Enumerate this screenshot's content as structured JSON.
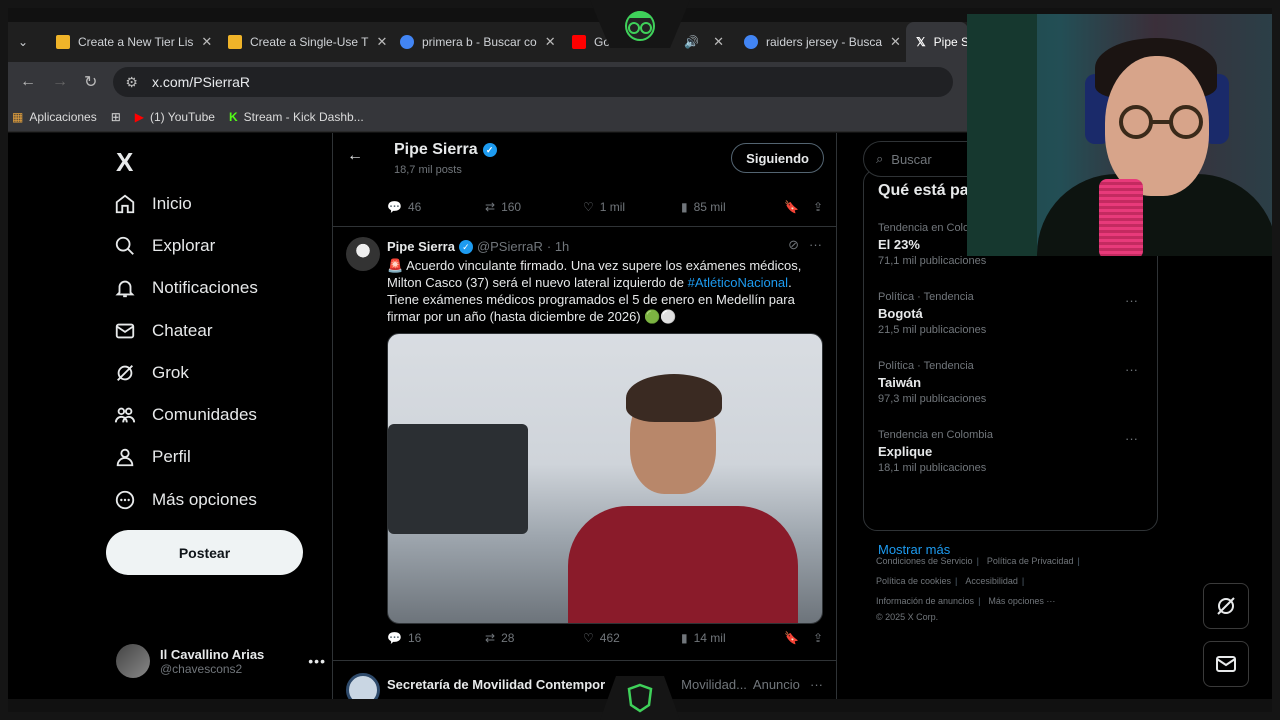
{
  "browser": {
    "tabs": [
      {
        "title": "Create a New Tier Lis",
        "icon_color": "#f0b429"
      },
      {
        "title": "Create a Single-Use T",
        "icon_color": "#f0b429"
      },
      {
        "title": "primera b - Buscar co",
        "icon_color": "#4285f4"
      },
      {
        "title": "Go",
        "icon_color": "#ff0000"
      },
      {
        "title": "raiders jersey - Busca",
        "icon_color": "#4285f4"
      },
      {
        "title": "Pipe Si",
        "icon_color": "#ffffff"
      }
    ],
    "url": "x.com/PSierraR",
    "bookmarks": [
      {
        "label": "Aplicaciones"
      },
      {
        "label": "(1) YouTube"
      },
      {
        "label": "Stream - Kick Dashb..."
      }
    ]
  },
  "sidebar": {
    "logo": "X",
    "items": [
      {
        "label": "Inicio",
        "icon": "home-icon"
      },
      {
        "label": "Explorar",
        "icon": "search-icon"
      },
      {
        "label": "Notificaciones",
        "icon": "bell-icon"
      },
      {
        "label": "Chatear",
        "icon": "mail-icon"
      },
      {
        "label": "Grok",
        "icon": "grok-icon"
      },
      {
        "label": "Comunidades",
        "icon": "people-icon"
      },
      {
        "label": "Perfil",
        "icon": "person-icon"
      },
      {
        "label": "Más opciones",
        "icon": "more-circle-icon"
      }
    ],
    "post_label": "Postear",
    "account": {
      "name": "Il Cavallino Arias",
      "handle": "@chavescons2",
      "more": "•••"
    }
  },
  "header": {
    "name": "Pipe Sierra",
    "posts": "18,7 mil posts",
    "follow_label": "Siguiendo"
  },
  "prev_actions": {
    "replies": "46",
    "reposts": "160",
    "likes": "1 mil",
    "views": "85 mil"
  },
  "tweet": {
    "name": "Pipe Sierra",
    "handle": "@PSierraR",
    "time": "· 1h",
    "text_before": "🚨 Acuerdo vinculante firmado. Una vez supere los exámenes médicos, Milton Casco (37) será el nuevo lateral izquierdo de ",
    "hashtag": "#AtléticoNacional",
    "text_after": ". Tiene exámenes médicos programados el 5 de enero en Medellín para firmar por un año (hasta diciembre de 2026) 🟢⚪",
    "actions": {
      "replies": "16",
      "reposts": "28",
      "likes": "462",
      "views": "14 mil"
    }
  },
  "ad": {
    "name": "Secretaría de Movilidad Contempor",
    "handle": "Movilidad...",
    "label": "Anuncio"
  },
  "right": {
    "search_placeholder": "Buscar",
    "trends_title": "Qué está pasando",
    "trends": [
      {
        "category": "Tendencia en Colombia",
        "title": "El 23%",
        "count": "71,1 mil publicaciones"
      },
      {
        "category": "Política · Tendencia",
        "title": "Bogotá",
        "count": "21,5 mil publicaciones"
      },
      {
        "category": "Política · Tendencia",
        "title": "Taiwán",
        "count": "97,3 mil publicaciones"
      },
      {
        "category": "Tendencia en Colombia",
        "title": "Explique",
        "count": "18,1 mil publicaciones"
      }
    ],
    "show_more": "Mostrar más",
    "footer": [
      "Condiciones de Servicio",
      "Política de Privacidad",
      "Política de cookies",
      "Accesibilidad",
      "Información de anuncios",
      "Más opciones ···",
      "© 2025 X Corp."
    ]
  },
  "colors": {
    "accent": "#1d9bf0",
    "background": "#000000",
    "border": "#2f3336"
  }
}
